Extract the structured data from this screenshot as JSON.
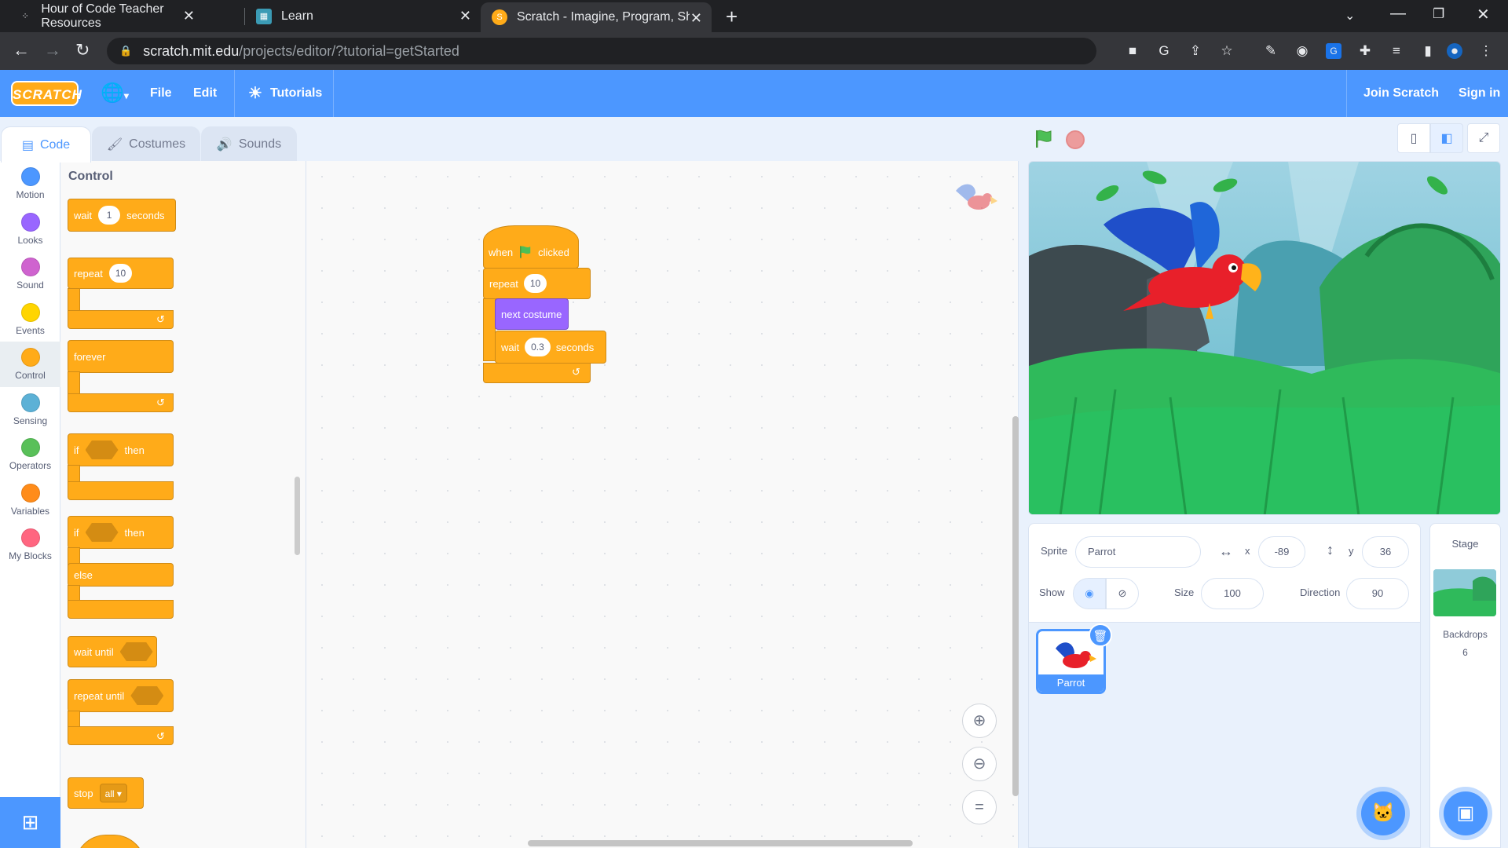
{
  "browser": {
    "tabs": [
      {
        "title": "Hour of Code Teacher Resources"
      },
      {
        "title": "Learn"
      },
      {
        "title": "Scratch - Imagine, Program, Shar"
      }
    ],
    "url_host": "scratch.mit.edu",
    "url_path": "/projects/editor/?tutorial=getStarted"
  },
  "menubar": {
    "logo": "SCRATCH",
    "file": "File",
    "edit": "Edit",
    "tutorials": "Tutorials",
    "join": "Join Scratch",
    "signin": "Sign in"
  },
  "editor_tabs": {
    "code": "Code",
    "costumes": "Costumes",
    "sounds": "Sounds"
  },
  "categories": [
    {
      "label": "Motion",
      "color": "#4c97ff"
    },
    {
      "label": "Looks",
      "color": "#9966ff"
    },
    {
      "label": "Sound",
      "color": "#cf63cf"
    },
    {
      "label": "Events",
      "color": "#ffd500"
    },
    {
      "label": "Control",
      "color": "#ffab19"
    },
    {
      "label": "Sensing",
      "color": "#5cb1d6"
    },
    {
      "label": "Operators",
      "color": "#59c059"
    },
    {
      "label": "Variables",
      "color": "#ff8c1a"
    },
    {
      "label": "My Blocks",
      "color": "#ff6680"
    }
  ],
  "palette": {
    "heading": "Control",
    "wait": {
      "pre": "wait",
      "value": "1",
      "post": "seconds"
    },
    "repeat": {
      "label": "repeat",
      "value": "10"
    },
    "forever": "forever",
    "if_then": {
      "if": "if",
      "then": "then"
    },
    "if_else": {
      "if": "if",
      "then": "then",
      "else": "else"
    },
    "wait_until": "wait until",
    "repeat_until": "repeat until",
    "stop": {
      "label": "stop",
      "option": "all"
    }
  },
  "script": {
    "hat": {
      "when": "when",
      "clicked": "clicked"
    },
    "repeat": {
      "label": "repeat",
      "value": "10"
    },
    "next_costume": "next costume",
    "wait": {
      "pre": "wait",
      "value": "0.3",
      "post": "seconds"
    }
  },
  "sprite_info": {
    "sprite_label": "Sprite",
    "sprite_name": "Parrot",
    "x_label": "x",
    "x": "-89",
    "y_label": "y",
    "y": "36",
    "show_label": "Show",
    "size_label": "Size",
    "size": "100",
    "direction_label": "Direction",
    "direction": "90"
  },
  "sprites": [
    {
      "name": "Parrot"
    }
  ],
  "stage_pane": {
    "title": "Stage",
    "backdrops_label": "Backdrops",
    "backdrops_count": "6"
  },
  "colors": {
    "scratch_blue": "#4c97ff",
    "control": "#ffab19",
    "looks": "#9966ff"
  }
}
